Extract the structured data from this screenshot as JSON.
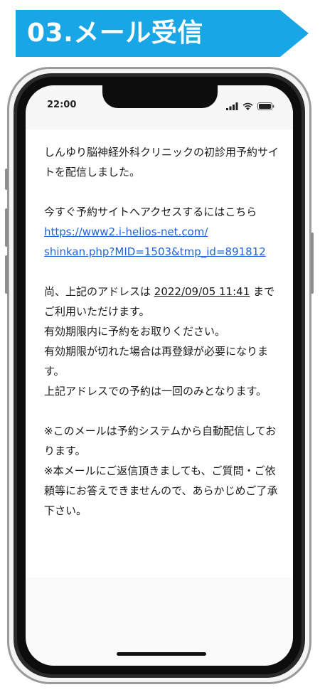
{
  "header": {
    "title": "03.メール受信"
  },
  "status_bar": {
    "time": "22:00"
  },
  "email": {
    "intro": "しんゆり脳神経外科クリニックの初診用予約サイトを配信しました。",
    "access_prompt": "今すぐ予約サイトへアクセスするにはこちら",
    "link_line1": "https://www2.i-helios-net.com/",
    "link_line2": "shinkan.php?MID=1503&tmp_id=891812",
    "expiry_prefix": "尚、上記のアドレスは ",
    "expiry_date": "2022/09/05 11:41",
    "expiry_suffix": " までご利用いただけます。",
    "reserve_within": "有効期限内に予約をお取りください。",
    "expired_note": "有効期限が切れた場合は再登録が必要になります。",
    "once_note": "上記アドレスでの予約は一回のみとなります。",
    "auto_note": "※このメールは予約システムから自動配信しております。",
    "no_reply_note": "※本メールにご返信頂きましても、ご質問・ご依頼等にお答えできませんので、あらかじめご了承下さい。"
  },
  "icons": {
    "signal": "signal-icon",
    "wifi": "wifi-icon",
    "battery": "battery-icon"
  },
  "colors": {
    "banner": "#19a6e6",
    "link": "#1f63d6"
  }
}
